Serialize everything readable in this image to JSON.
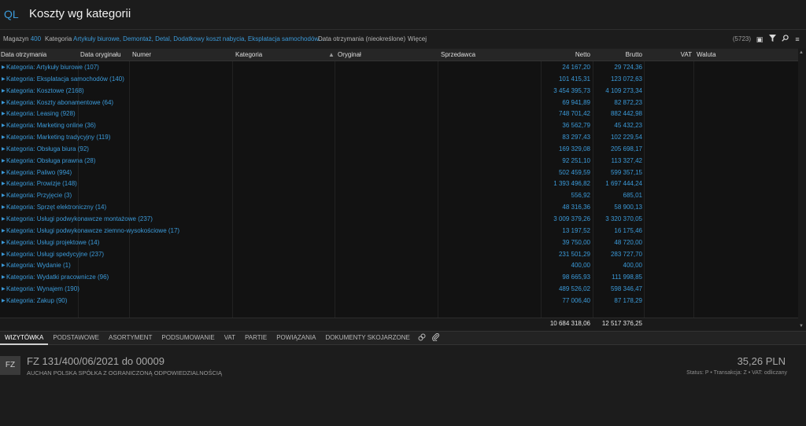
{
  "app": {
    "logo": "QL",
    "title": "Koszty wg kategorii"
  },
  "filters": {
    "magazyn_label": "Magazyn",
    "magazyn_value": "400",
    "kategoria_label": "Kategoria",
    "kategoria_value": "Artykuły biurowe, Demontaż, Detal, Dodatkowy koszt nabycia, Eksplatacja samochodów...",
    "data_label": "Data otrzymania (nieokreślone)",
    "more_label": "Więcej",
    "count": "(5723)"
  },
  "icons": {
    "export": "export-icon",
    "filter": "filter-icon",
    "search": "search-icon",
    "menu": "menu-icon"
  },
  "columns": {
    "data_otrzymania": "Data otrzymania",
    "data_oryginalu": "Data oryginału",
    "numer": "Numer",
    "kategoria": "Kategoria",
    "oryginal": "Oryginał",
    "sprzedawca": "Sprzedawca",
    "netto": "Netto",
    "brutto": "Brutto",
    "vat": "VAT",
    "waluta": "Waluta"
  },
  "rows": [
    {
      "label": "Kategoria: Artykuły biurowe (107)",
      "netto": "24 167,20",
      "brutto": "29 724,36"
    },
    {
      "label": "Kategoria: Eksplatacja samochodów (140)",
      "netto": "101 415,31",
      "brutto": "123 072,63"
    },
    {
      "label": "Kategoria: Kosztowe (2168)",
      "netto": "3 454 395,73",
      "brutto": "4 109 273,34"
    },
    {
      "label": "Kategoria: Koszty abonamentowe (64)",
      "netto": "69 941,89",
      "brutto": "82 872,23"
    },
    {
      "label": "Kategoria: Leasing (928)",
      "netto": "748 701,42",
      "brutto": "882 442,98"
    },
    {
      "label": "Kategoria: Marketing online (36)",
      "netto": "36 562,79",
      "brutto": "45 432,23"
    },
    {
      "label": "Kategoria: Marketing tradycyjny (119)",
      "netto": "83 297,43",
      "brutto": "102 229,54"
    },
    {
      "label": "Kategoria: Obsługa biura (92)",
      "netto": "169 329,08",
      "brutto": "205 698,17"
    },
    {
      "label": "Kategoria: Obsługa prawna (28)",
      "netto": "92 251,10",
      "brutto": "113 327,42"
    },
    {
      "label": "Kategoria: Paliwo (994)",
      "netto": "502 459,59",
      "brutto": "599 357,15"
    },
    {
      "label": "Kategoria: Prowizje (148)",
      "netto": "1 393 496,82",
      "brutto": "1 697 444,24"
    },
    {
      "label": "Kategoria: Przyjęcie (3)",
      "netto": "556,92",
      "brutto": "685,01"
    },
    {
      "label": "Kategoria: Sprzęt elektroniczny (14)",
      "netto": "48 316,36",
      "brutto": "58 900,13"
    },
    {
      "label": "Kategoria: Usługi podwykonawcze montażowe (237)",
      "netto": "3 009 379,26",
      "brutto": "3 320 370,05"
    },
    {
      "label": "Kategoria: Usługi podwykonawcze ziemno-wysokościowe (17)",
      "netto": "13 197,52",
      "brutto": "16 175,46"
    },
    {
      "label": "Kategoria: Usługi projektowe (14)",
      "netto": "39 750,00",
      "brutto": "48 720,00"
    },
    {
      "label": "Kategoria: Usługi spedycyjne (237)",
      "netto": "231 501,29",
      "brutto": "283 727,70"
    },
    {
      "label": "Kategoria: Wydanie (1)",
      "netto": "400,00",
      "brutto": "400,00"
    },
    {
      "label": "Kategoria: Wydatki pracownicze (96)",
      "netto": "98 665,93",
      "brutto": "111 998,85"
    },
    {
      "label": "Kategoria: Wynajem (190)",
      "netto": "489 526,02",
      "brutto": "598 346,47"
    },
    {
      "label": "Kategoria: Zakup (90)",
      "netto": "77 006,40",
      "brutto": "87 178,29"
    }
  ],
  "totals": {
    "netto": "10 684 318,06",
    "brutto": "12 517 376,25"
  },
  "tabs": [
    "WIZYTÓWKA",
    "PODSTAWOWE",
    "ASORTYMENT",
    "PODSUMOWANIE",
    "VAT",
    "PARTIE",
    "POWIĄZANIA",
    "DOKUMENTY SKOJARZONE"
  ],
  "detail": {
    "badge": "FZ",
    "title": "FZ 131/400/06/2021 do 00009",
    "company": "AUCHAN POLSKA SPÓŁKA Z OGRANICZONĄ ODPOWIEDZIALNOŚCIĄ",
    "amount": "35,26 PLN",
    "status": "Status: P  •  Transakcja: Z  •  VAT: odliczany"
  }
}
